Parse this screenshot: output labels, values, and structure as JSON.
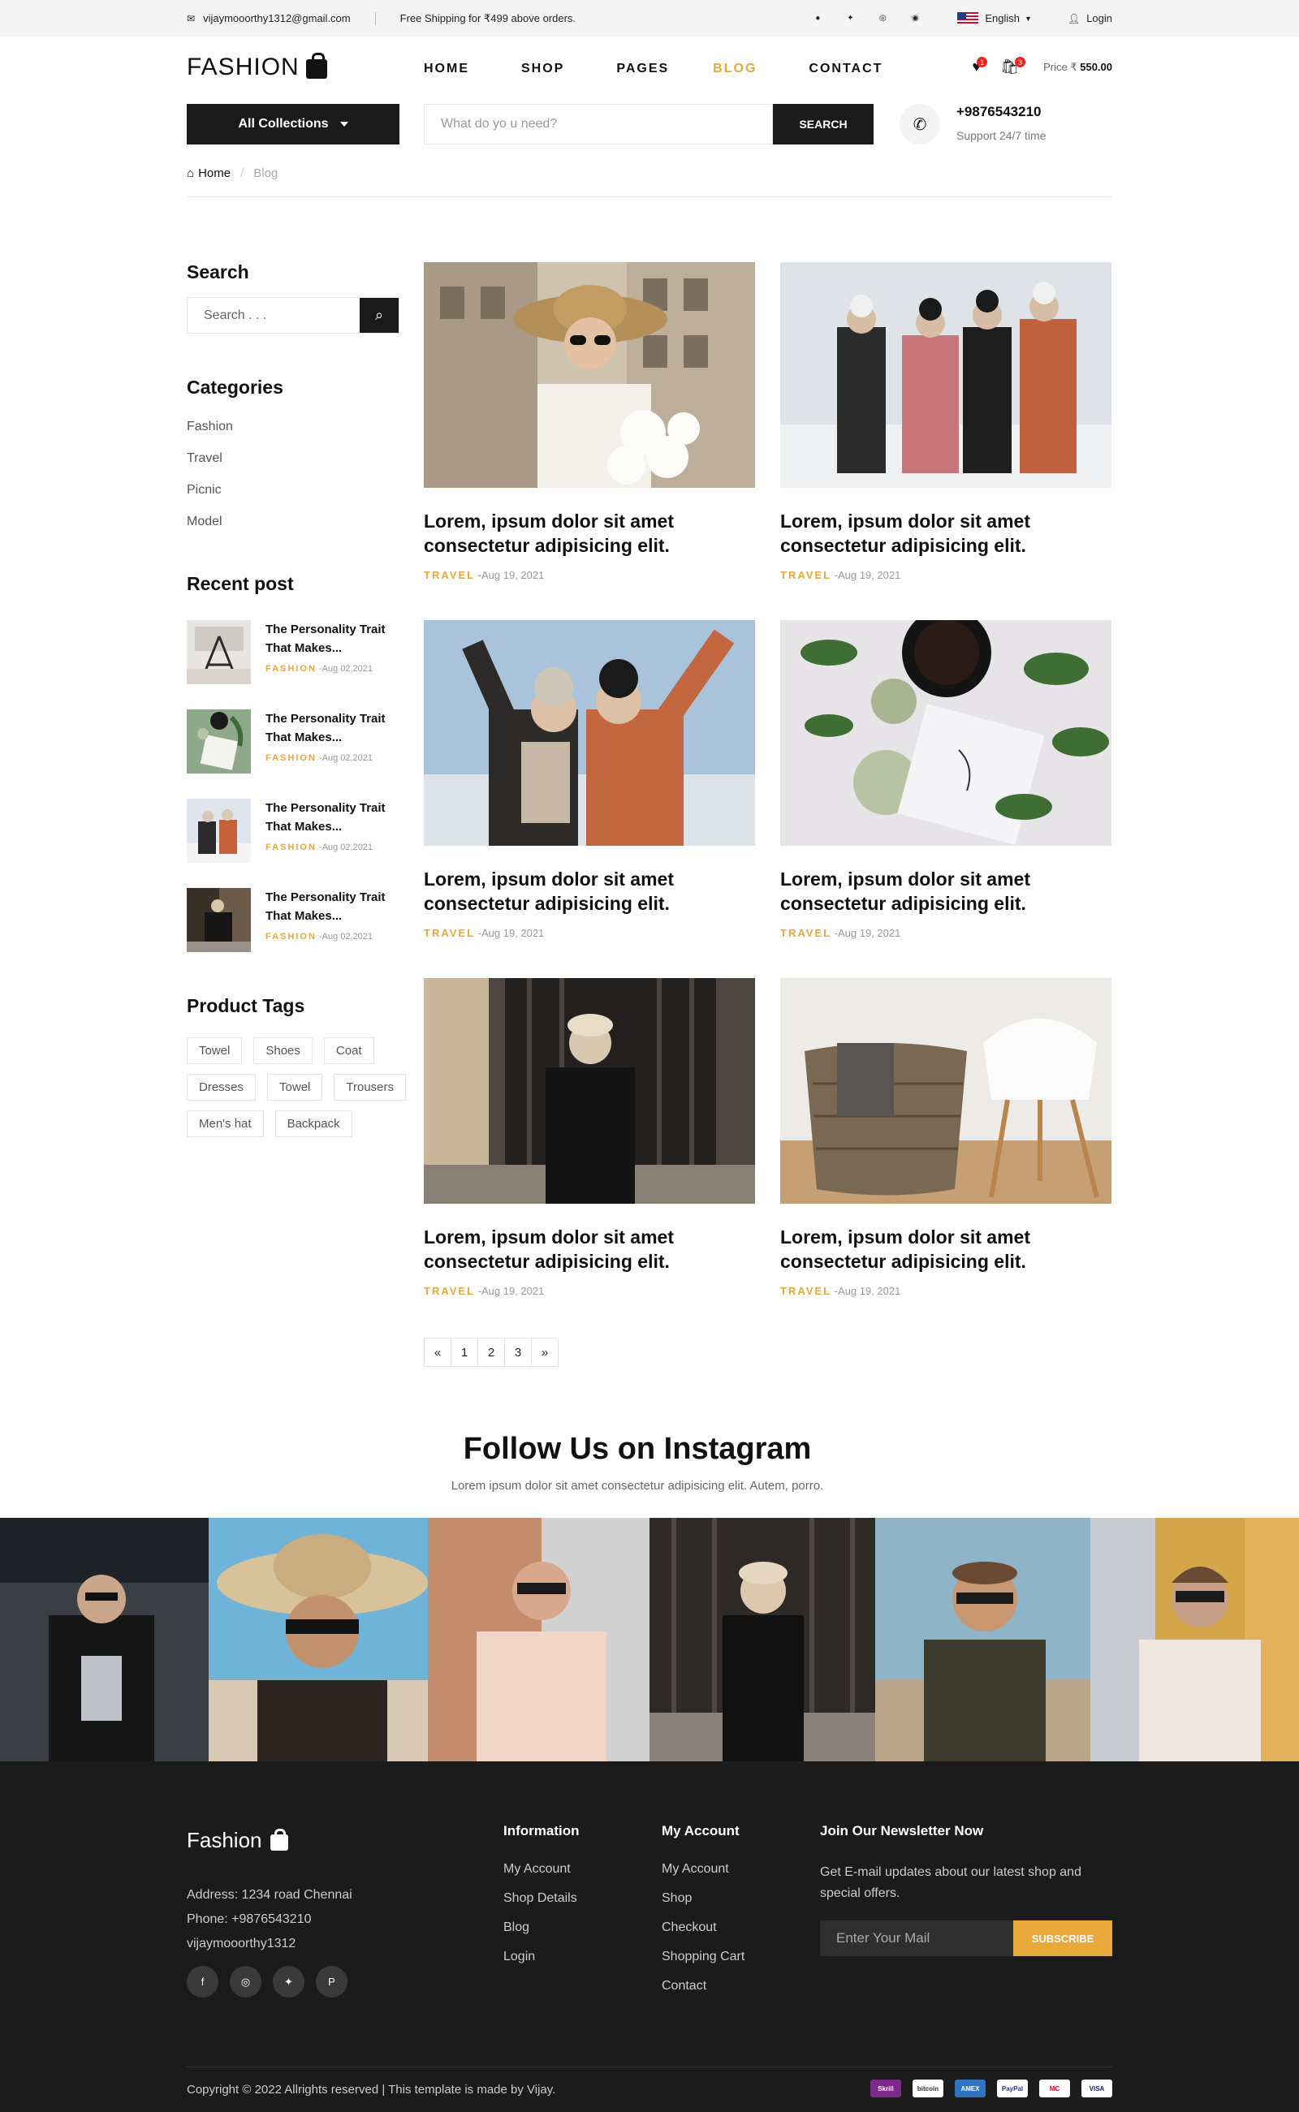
{
  "topbar": {
    "email": "vijaymooorthy1312@gmail.com",
    "shipping": "Free Shipping for ₹499 above orders.",
    "language": "English",
    "login": "Login"
  },
  "header": {
    "logo": "FASHION",
    "nav": [
      "HOME",
      "SHOP",
      "PAGES",
      "BLOG",
      "CONTACT"
    ],
    "active_nav": "BLOG",
    "wishlist_count": "1",
    "cart_count": "3",
    "price_label": "Price ₹",
    "price_value": "550.00",
    "all_collections": "All Collections",
    "search_placeholder": "What do yo u need?",
    "search_button": "SEARCH",
    "phone": "+9876543210",
    "support": "Support 24/7 time"
  },
  "breadcrumb": {
    "home": "Home",
    "current": "Blog"
  },
  "sidebar": {
    "search_title": "Search",
    "search_placeholder": "Search . . .",
    "categories_title": "Categories",
    "categories": [
      "Fashion",
      "Travel",
      "Picnic",
      "Model"
    ],
    "recent_title": "Recent post",
    "recent_posts": [
      {
        "title": "The Personality Trait That Makes...",
        "category": "FASHION",
        "date": "-Aug 02,2021"
      },
      {
        "title": "The Personality Trait That Makes...",
        "category": "FASHION",
        "date": "-Aug 02,2021"
      },
      {
        "title": "The Personality Trait That Makes...",
        "category": "FASHION",
        "date": "-Aug 02,2021"
      },
      {
        "title": "The Personality Trait That Makes...",
        "category": "FASHION",
        "date": "-Aug 02,2021"
      }
    ],
    "tags_title": "Product Tags",
    "tags": [
      "Towel",
      "Shoes",
      "Coat",
      "Dresses",
      "Towel",
      "Trousers",
      "Men's hat",
      "Backpack"
    ]
  },
  "posts": [
    {
      "title": "Lorem, ipsum dolor sit amet consectetur adipisicing elit.",
      "category": "TRAVEL",
      "date": "-Aug 19, 2021"
    },
    {
      "title": "Lorem, ipsum dolor sit amet consectetur adipisicing elit.",
      "category": "TRAVEL",
      "date": "-Aug 19, 2021"
    },
    {
      "title": "Lorem, ipsum dolor sit amet consectetur adipisicing elit.",
      "category": "TRAVEL",
      "date": "-Aug 19, 2021"
    },
    {
      "title": "Lorem, ipsum dolor sit amet consectetur adipisicing elit.",
      "category": "TRAVEL",
      "date": "-Aug 19, 2021"
    },
    {
      "title": "Lorem, ipsum dolor sit amet consectetur adipisicing elit.",
      "category": "TRAVEL",
      "date": "-Aug 19, 2021"
    },
    {
      "title": "Lorem, ipsum dolor sit amet consectetur adipisicing elit.",
      "category": "TRAVEL",
      "date": "-Aug 19, 2021"
    }
  ],
  "pagination": [
    "«",
    "1",
    "2",
    "3",
    "»"
  ],
  "instagram": {
    "title": "Follow Us on Instagram",
    "subtitle": "Lorem ipsum dolor sit amet consectetur adipisicing elit. Autem, porro."
  },
  "footer": {
    "logo": "Fashion",
    "address": "Address: 1234 road Chennai",
    "phone": "Phone: +9876543210",
    "email": "vijaymooorthy1312",
    "info_title": "Information",
    "info_links": [
      "My Account",
      "Shop Details",
      "Blog",
      "Login"
    ],
    "account_title": "My Account",
    "account_links": [
      "My Account",
      "Shop",
      "Checkout",
      "Shopping Cart",
      "Contact"
    ],
    "newsletter_title": "Join Our Newsletter Now",
    "newsletter_text": "Get E-mail updates about our latest shop and special offers.",
    "newsletter_placeholder": "Enter Your Mail",
    "subscribe": "SUBSCRIBE",
    "copyright": "Copyright © 2022 Allrights reserved | This template is made by Vijay.",
    "payments": [
      "Skrill",
      "bitcoin",
      "AMEX",
      "PayPal",
      "MC",
      "VISA"
    ]
  },
  "colors": {
    "accent": "#e8a83a",
    "dark": "#1a1a1a",
    "footer_bg": "#1b1b1b",
    "badge": "#e22222"
  }
}
